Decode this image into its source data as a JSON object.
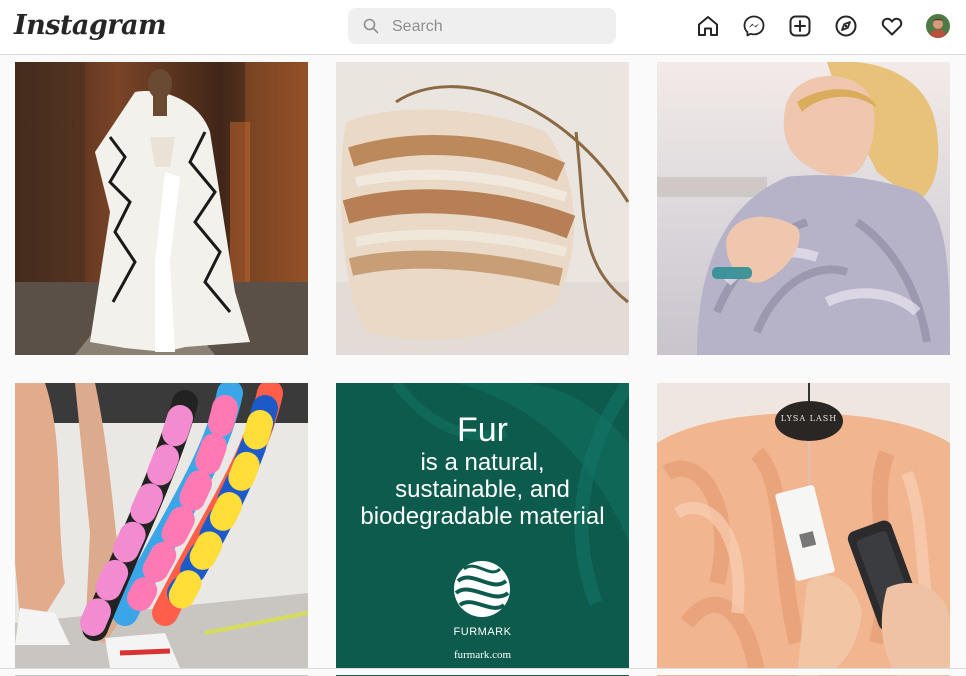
{
  "header": {
    "logo_text": "Instagram",
    "search": {
      "placeholder": "Search",
      "value": ""
    },
    "nav_icons": [
      "home-icon",
      "messenger-icon",
      "new-post-icon",
      "explore-icon",
      "activity-heart-icon",
      "profile-avatar"
    ]
  },
  "posts": [
    {
      "name": "runway-white-fur-coat"
    },
    {
      "name": "fox-fur-bag"
    },
    {
      "name": "woman-silver-fox-fur"
    },
    {
      "name": "colorful-fur-scarves"
    },
    {
      "name": "furmark-ad",
      "title": "Fur",
      "line1": "is a natural,",
      "line2": "sustainable, and",
      "line3": "biodegradable material",
      "brand": "FURMARK",
      "url": "furmark.com",
      "bg_color": "#0c5b4d"
    },
    {
      "name": "peach-fur-tag-phone",
      "tag_text": "LYSA LASH"
    }
  ],
  "colors": {
    "header_bg": "#ffffff",
    "page_bg": "#fafafa",
    "border": "#dbdbdb",
    "icon": "#262626",
    "search_bg": "#efefef"
  }
}
